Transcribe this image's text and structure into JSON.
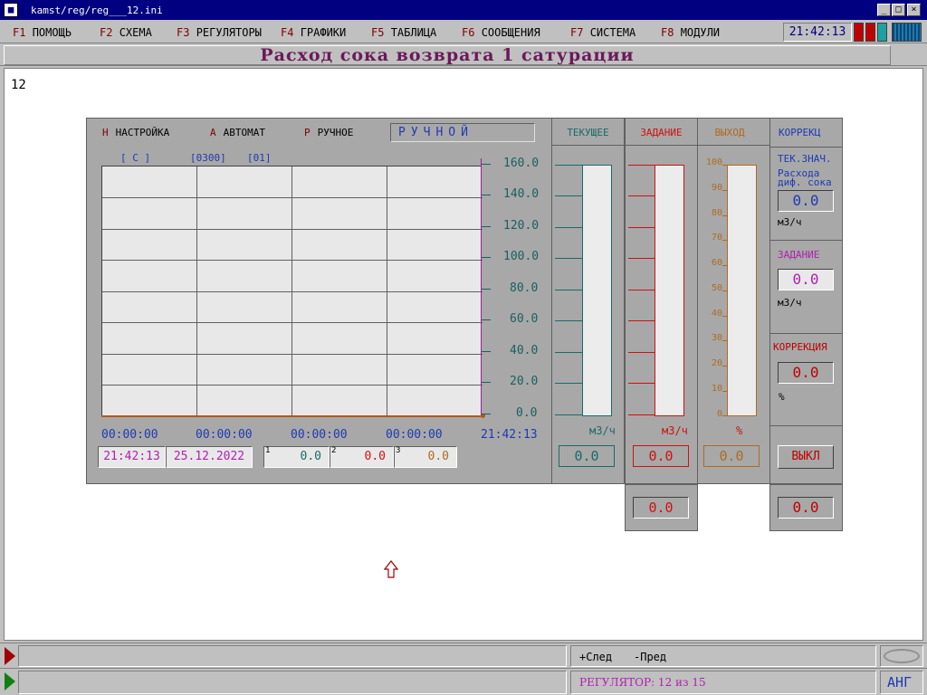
{
  "window": {
    "title": "kamst/reg/reg___12.ini",
    "minimize": "_",
    "maximize": "□",
    "close": "×"
  },
  "menu": [
    {
      "key": "F1",
      "label": "ПОМОЩЬ"
    },
    {
      "key": "F2",
      "label": "СХЕМА"
    },
    {
      "key": "F3",
      "label": "РЕГУЛЯТОРЫ"
    },
    {
      "key": "F4",
      "label": "ГРАФИКИ"
    },
    {
      "key": "F5",
      "label": "ТАБЛИЦА"
    },
    {
      "key": "F6",
      "label": "СООБЩЕНИЯ"
    },
    {
      "key": "F7",
      "label": "СИСТЕМА"
    },
    {
      "key": "F8",
      "label": "МОДУЛИ"
    }
  ],
  "clock": "21:42:13",
  "page_title": "Расход сока возврата 1 сатурации",
  "page_number": "12",
  "modes": {
    "setup_key": "Н",
    "setup_label": "НАСТРОЙКА",
    "auto_key": "А",
    "auto_label": "АВТОМАТ",
    "manual_key": "Р",
    "manual_label": "РУЧНОЕ",
    "current_mode": "РУЧНОЙ"
  },
  "trend": {
    "header_c": "[ С ]",
    "header_range": "[0300]",
    "header_num": "[01]",
    "y_labels": [
      "160.0",
      "140.0",
      "120.0",
      "100.0",
      "80.0",
      "60.0",
      "40.0",
      "20.0",
      "0.0"
    ],
    "x_labels": [
      "00:00:00",
      "00:00:00",
      "00:00:00",
      "00:00:00",
      "21:42:13"
    ],
    "time": "21:42:13",
    "date": "25.12.2022",
    "values": [
      {
        "n": "1",
        "v": "0.0"
      },
      {
        "n": "2",
        "v": "0.0"
      },
      {
        "n": "3",
        "v": "0.0"
      }
    ]
  },
  "columns": {
    "current": {
      "title": "ТЕКУЩЕЕ",
      "unit": "м3/ч",
      "value": "0.0"
    },
    "setpoint": {
      "title": "ЗАДАНИЕ",
      "unit": "м3/ч",
      "value": "0.0",
      "value2": "0.0"
    },
    "output": {
      "title": "ВЫХОД",
      "unit": "%",
      "value": "0.0",
      "scale": [
        "100",
        "90",
        "80",
        "70",
        "60",
        "50",
        "40",
        "30",
        "20",
        "10",
        "0"
      ]
    },
    "correction": {
      "title": "КОРРЕКЦ",
      "tek_label": "ТЕК.ЗНАЧ.",
      "tek_desc1": "Расхода",
      "tek_desc2": "диф. сока",
      "tek_value": "0.0",
      "tek_unit": "м3/ч",
      "zad_label": "ЗАДАНИЕ",
      "zad_value": "0.0",
      "zad_unit": "м3/ч",
      "kor_label": "КОРРЕКЦИЯ",
      "kor_value": "0.0",
      "kor_unit": "%",
      "off_button": "ВЫКЛ",
      "bottom_value": "0.0"
    }
  },
  "status": {
    "next": "+След",
    "prev": "-Пред",
    "regulator": "РЕГУЛЯТОР:  12  из  15",
    "lang": "АНГ"
  },
  "colors": {
    "teal": "#1a6a6a",
    "red": "#d01010",
    "orange": "#b06a20",
    "blue": "#1e3ab4",
    "magenta": "#b020b0",
    "title": "#6a1a5a"
  }
}
